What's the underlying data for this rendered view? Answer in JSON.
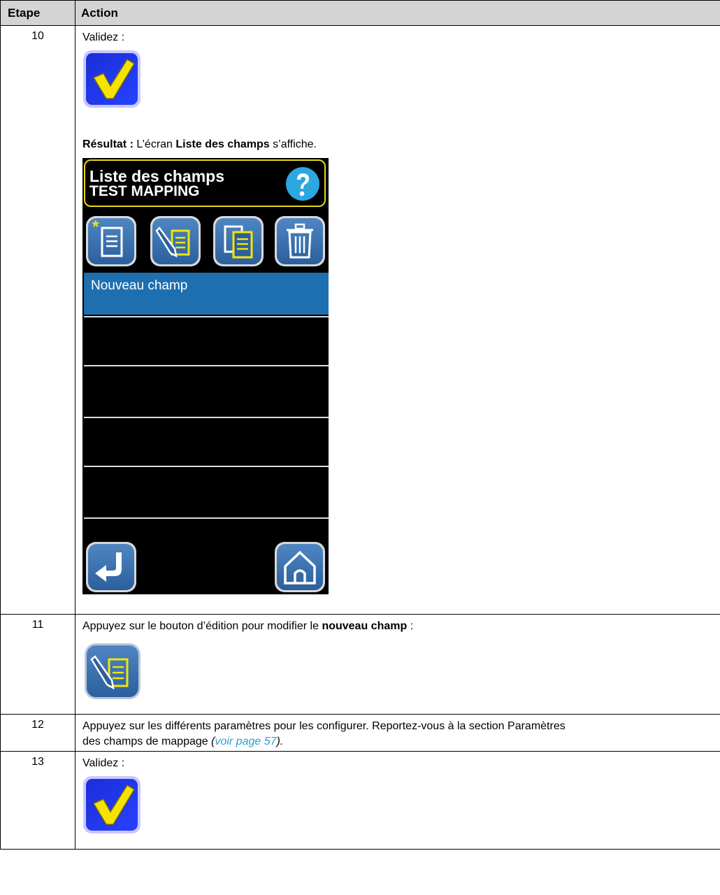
{
  "table": {
    "headers": {
      "step": "Etape",
      "action": "Action"
    }
  },
  "steps": [
    {
      "num": "10",
      "text": "Validez :",
      "result_label": "Résultat :",
      "result_pre": "L’écran",
      "result_bold": "Liste des champs",
      "result_post": "s’affiche.",
      "screen": {
        "title_line1": "Liste des champs",
        "title_line2": "TEST MAPPING",
        "selected_item": "Nouveau champ"
      }
    },
    {
      "num": "11",
      "text_pre": "Appuyez sur le bouton d’édition pour modifier le",
      "text_bold": "nouveau champ",
      "text_post": ":"
    },
    {
      "num": "12",
      "text_line1": "Appuyez sur les différents paramètres pour les configurer. Reportez-vous à la section Paramètres",
      "text_line2_pre": "des champs de mappage",
      "text_paren_open": "(",
      "link_text": "voir page 57",
      "text_paren_close": ")."
    },
    {
      "num": "13",
      "text": "Validez :"
    }
  ],
  "colors": {
    "header_bg": "#d4d4d4",
    "selected_row": "#1e6fb0",
    "accent_yellow": "#f5e400",
    "link": "#2a9fd8"
  }
}
